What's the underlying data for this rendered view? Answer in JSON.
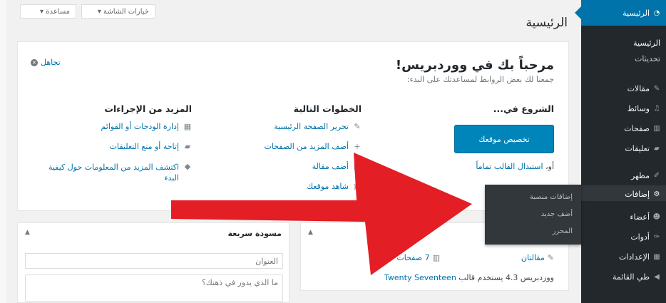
{
  "header": {
    "screen_options": "خيارات الشاشة ▾",
    "help": "مساعدة ▾",
    "page_title": "الرئيسية"
  },
  "sidebar": {
    "dashboard": "الرئيسية",
    "sub_home": "الرئيسية",
    "sub_updates": "تحديثات",
    "items": [
      {
        "label": "مقالات",
        "icon": "pin-icon"
      },
      {
        "label": "وسائط",
        "icon": "media-icon"
      },
      {
        "label": "صفحات",
        "icon": "pages-icon"
      },
      {
        "label": "تعليقات",
        "icon": "comments-icon"
      },
      {
        "label": "مظهر",
        "icon": "appearance-icon"
      },
      {
        "label": "إضافات",
        "icon": "plugins-icon"
      },
      {
        "label": "أعضاء",
        "icon": "users-icon"
      },
      {
        "label": "أدوات",
        "icon": "tools-icon"
      },
      {
        "label": "الإعدادات",
        "icon": "settings-icon"
      },
      {
        "label": "طي القائمة",
        "icon": "collapse-icon"
      }
    ]
  },
  "welcome": {
    "title": "مرحباً بك في ووردبريس!",
    "subtitle": "جمعنا لك بعض الروابط لمساعدتك على البدء:",
    "dismiss": "تجاهل",
    "get_started": {
      "heading": "الشروع في...",
      "button": "تخصيص موقعك",
      "alt_prefix": "أو،",
      "alt_link": "استبدال القالب تماماً"
    },
    "next_steps": {
      "heading": "الخطوات التالية",
      "items": [
        {
          "label": "تحرير الصفحة الرئيسية",
          "icon": "edit-icon"
        },
        {
          "label": "أضف المزيد من الصفحات",
          "icon": "plus-icon"
        },
        {
          "label": "أضف مقالة",
          "icon": "post-icon"
        },
        {
          "label": "شاهد موقعك",
          "icon": "view-icon"
        }
      ]
    },
    "more_actions": {
      "heading": "المزيد من الإجراءات",
      "items": [
        {
          "label": "إدارة الودجات أو القوائم",
          "icon": "widgets-icon"
        },
        {
          "label": "إتاحة أو منع التعليقات",
          "icon": "comment-toggle-icon"
        },
        {
          "label": "اكتشف المزيد من المعلومات حول كيفية",
          "label2": "البدء",
          "icon": "learn-icon"
        }
      ]
    }
  },
  "glance": {
    "posts": "مقالتان",
    "pages": "7 صفحات",
    "version_text": "ووردبريس 4.3 يستخدم قالب",
    "theme": "Twenty Seventeen"
  },
  "quick_draft": {
    "heading": "مسودة سريعة",
    "title_placeholder": "العنوان",
    "content_placeholder": "ما الذي يدور في ذهنك؟"
  },
  "plugins_flyout": {
    "items": [
      "إضافات منصبة",
      "أضف جديد",
      "المحرر"
    ]
  },
  "colors": {
    "sidebar": "#23282d",
    "accent": "#0073aa",
    "button": "#0085ba",
    "arrow": "#e31e24"
  }
}
